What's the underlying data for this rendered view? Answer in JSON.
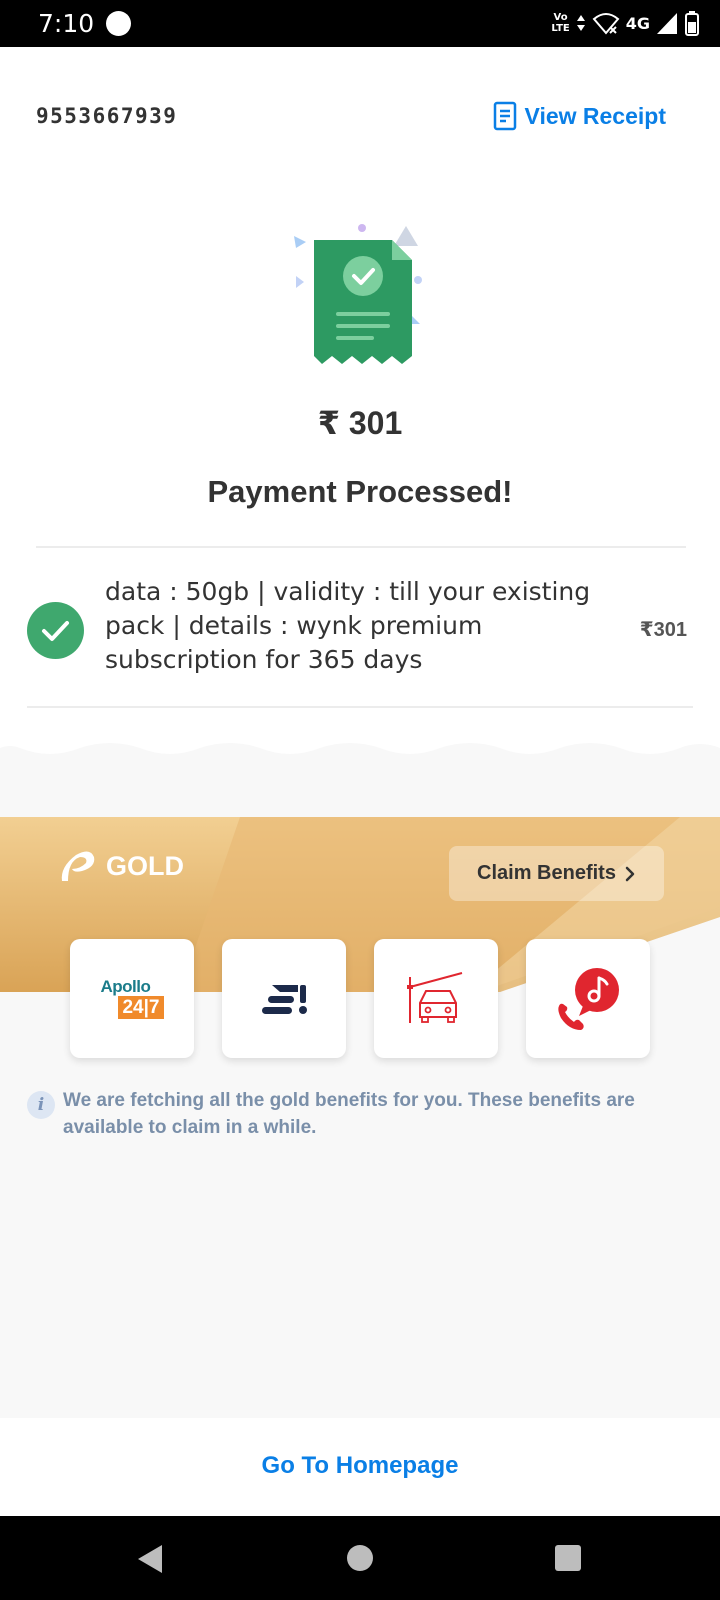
{
  "status_bar": {
    "time": "7:10",
    "volte_line1": "Vo",
    "volte_line2": "LTE",
    "network": "4G"
  },
  "header": {
    "phone_number": "9553667939",
    "view_receipt_label": "View Receipt",
    "receipt_icon": "receipt-icon"
  },
  "payment": {
    "amount": "₹ 301",
    "status_title": "Payment Processed!",
    "accent_color": "#3fa86e"
  },
  "pack": {
    "description": "data : 50gb | validity : till your existing pack | details : wynk premium subscription for 365 days",
    "price": "₹301"
  },
  "gold": {
    "brand_label": "GOLD",
    "claim_label": "Claim Benefits",
    "benefits": [
      {
        "name": "Apollo 24|7",
        "icon": "apollo-247-icon",
        "logo_top": "Apollo",
        "logo_bottom": "24|7"
      },
      {
        "name": "Shaw Academy",
        "icon": "shaw-academy-icon"
      },
      {
        "name": "FASTag",
        "icon": "car-toll-icon"
      },
      {
        "name": "Hellotunes",
        "icon": "hellotunes-icon"
      }
    ],
    "info_icon": "i",
    "info_text": "We are fetching all the gold benefits for you. These benefits are available to claim in a while."
  },
  "footer": {
    "home_label": "Go To Homepage"
  },
  "colors": {
    "link_blue": "#0a7fe6",
    "gold_light": "#f2cf92",
    "gold_dark": "#d9a356"
  }
}
